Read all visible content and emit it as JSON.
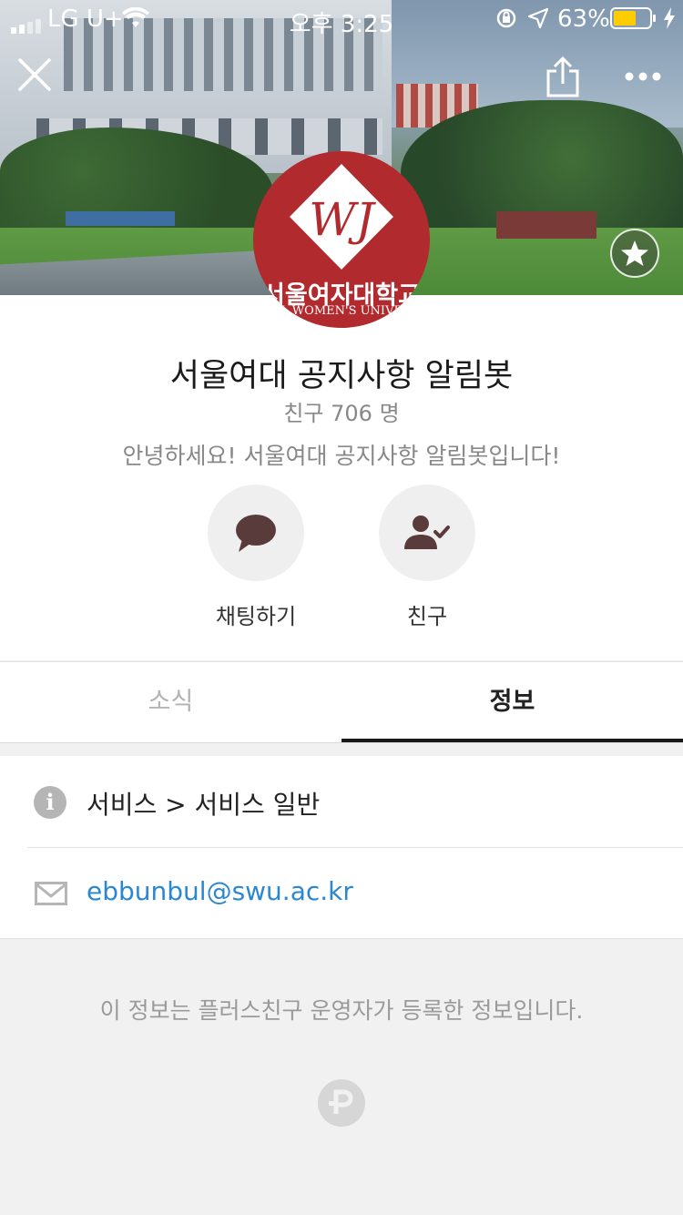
{
  "status_bar": {
    "carrier": "LG U+",
    "time": "오후 3:25",
    "battery": "63%",
    "battery_level": 0.63
  },
  "header": {
    "logo_text": "서울여자대학교",
    "logo_subtext": "L WOMEN'S UNIVE"
  },
  "profile": {
    "name": "서울여대 공지사항 알림봇",
    "friends": "친구 706 명",
    "greeting": "안녕하세요! 서울여대 공지사항 알림봇입니다!"
  },
  "actions": [
    {
      "label": "채팅하기",
      "icon": "chat-bubble-icon"
    },
    {
      "label": "친구",
      "icon": "person-check-icon"
    }
  ],
  "tabs": [
    {
      "label": "소식",
      "active": false
    },
    {
      "label": "정보",
      "active": true
    }
  ],
  "info": {
    "category": "서비스 > 서비스 일반",
    "email": "ebbunbul@swu.ac.kr"
  },
  "footer": {
    "note": "이 정보는 플러스친구 운영자가 등록한 정보입니다.",
    "logo_icon": "plus-friend-logo-icon"
  },
  "colors": {
    "link": "#2a87d1",
    "logo_red": "#b02a2e",
    "battery": "#ffcc00"
  }
}
